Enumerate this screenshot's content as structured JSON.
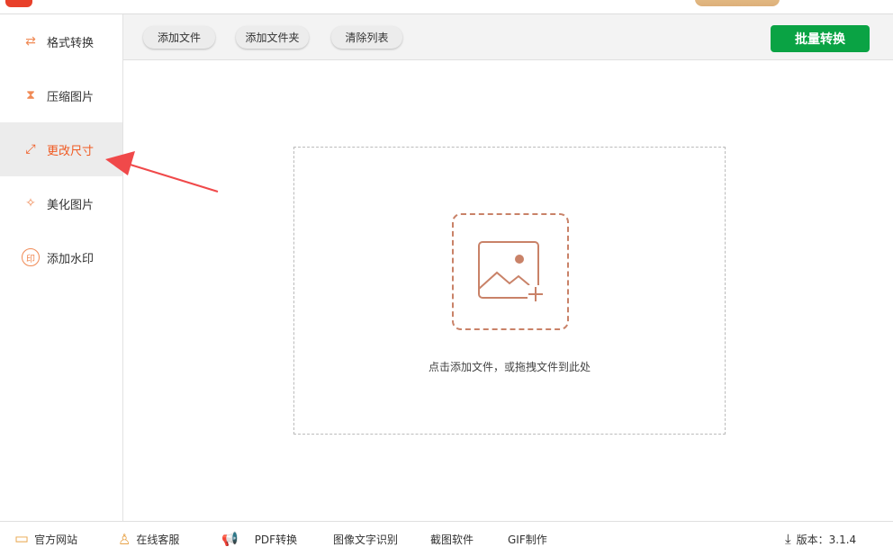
{
  "sidebar": {
    "items": [
      {
        "label": "格式转换",
        "icon": "format-convert-icon"
      },
      {
        "label": "压缩图片",
        "icon": "compress-icon"
      },
      {
        "label": "更改尺寸",
        "icon": "resize-icon",
        "active": true
      },
      {
        "label": "美化图片",
        "icon": "beautify-icon"
      },
      {
        "label": "添加水印",
        "icon": "watermark-icon",
        "glyph": "印"
      }
    ]
  },
  "toolbar": {
    "add_file": "添加文件",
    "add_folder": "添加文件夹",
    "clear_list": "清除列表",
    "batch_convert": "批量转换"
  },
  "dropzone": {
    "hint": "点击添加文件，或拖拽文件到此处"
  },
  "footer": {
    "website": "官方网站",
    "support": "在线客服",
    "pdf": "PDF转换",
    "ocr": "图像文字识别",
    "screenshot": "截图软件",
    "gif": "GIF制作",
    "version": "版本：3.1.4"
  },
  "colors": {
    "accent": "#f05a22",
    "green": "#0aa344",
    "arrow": "#f0494a"
  }
}
